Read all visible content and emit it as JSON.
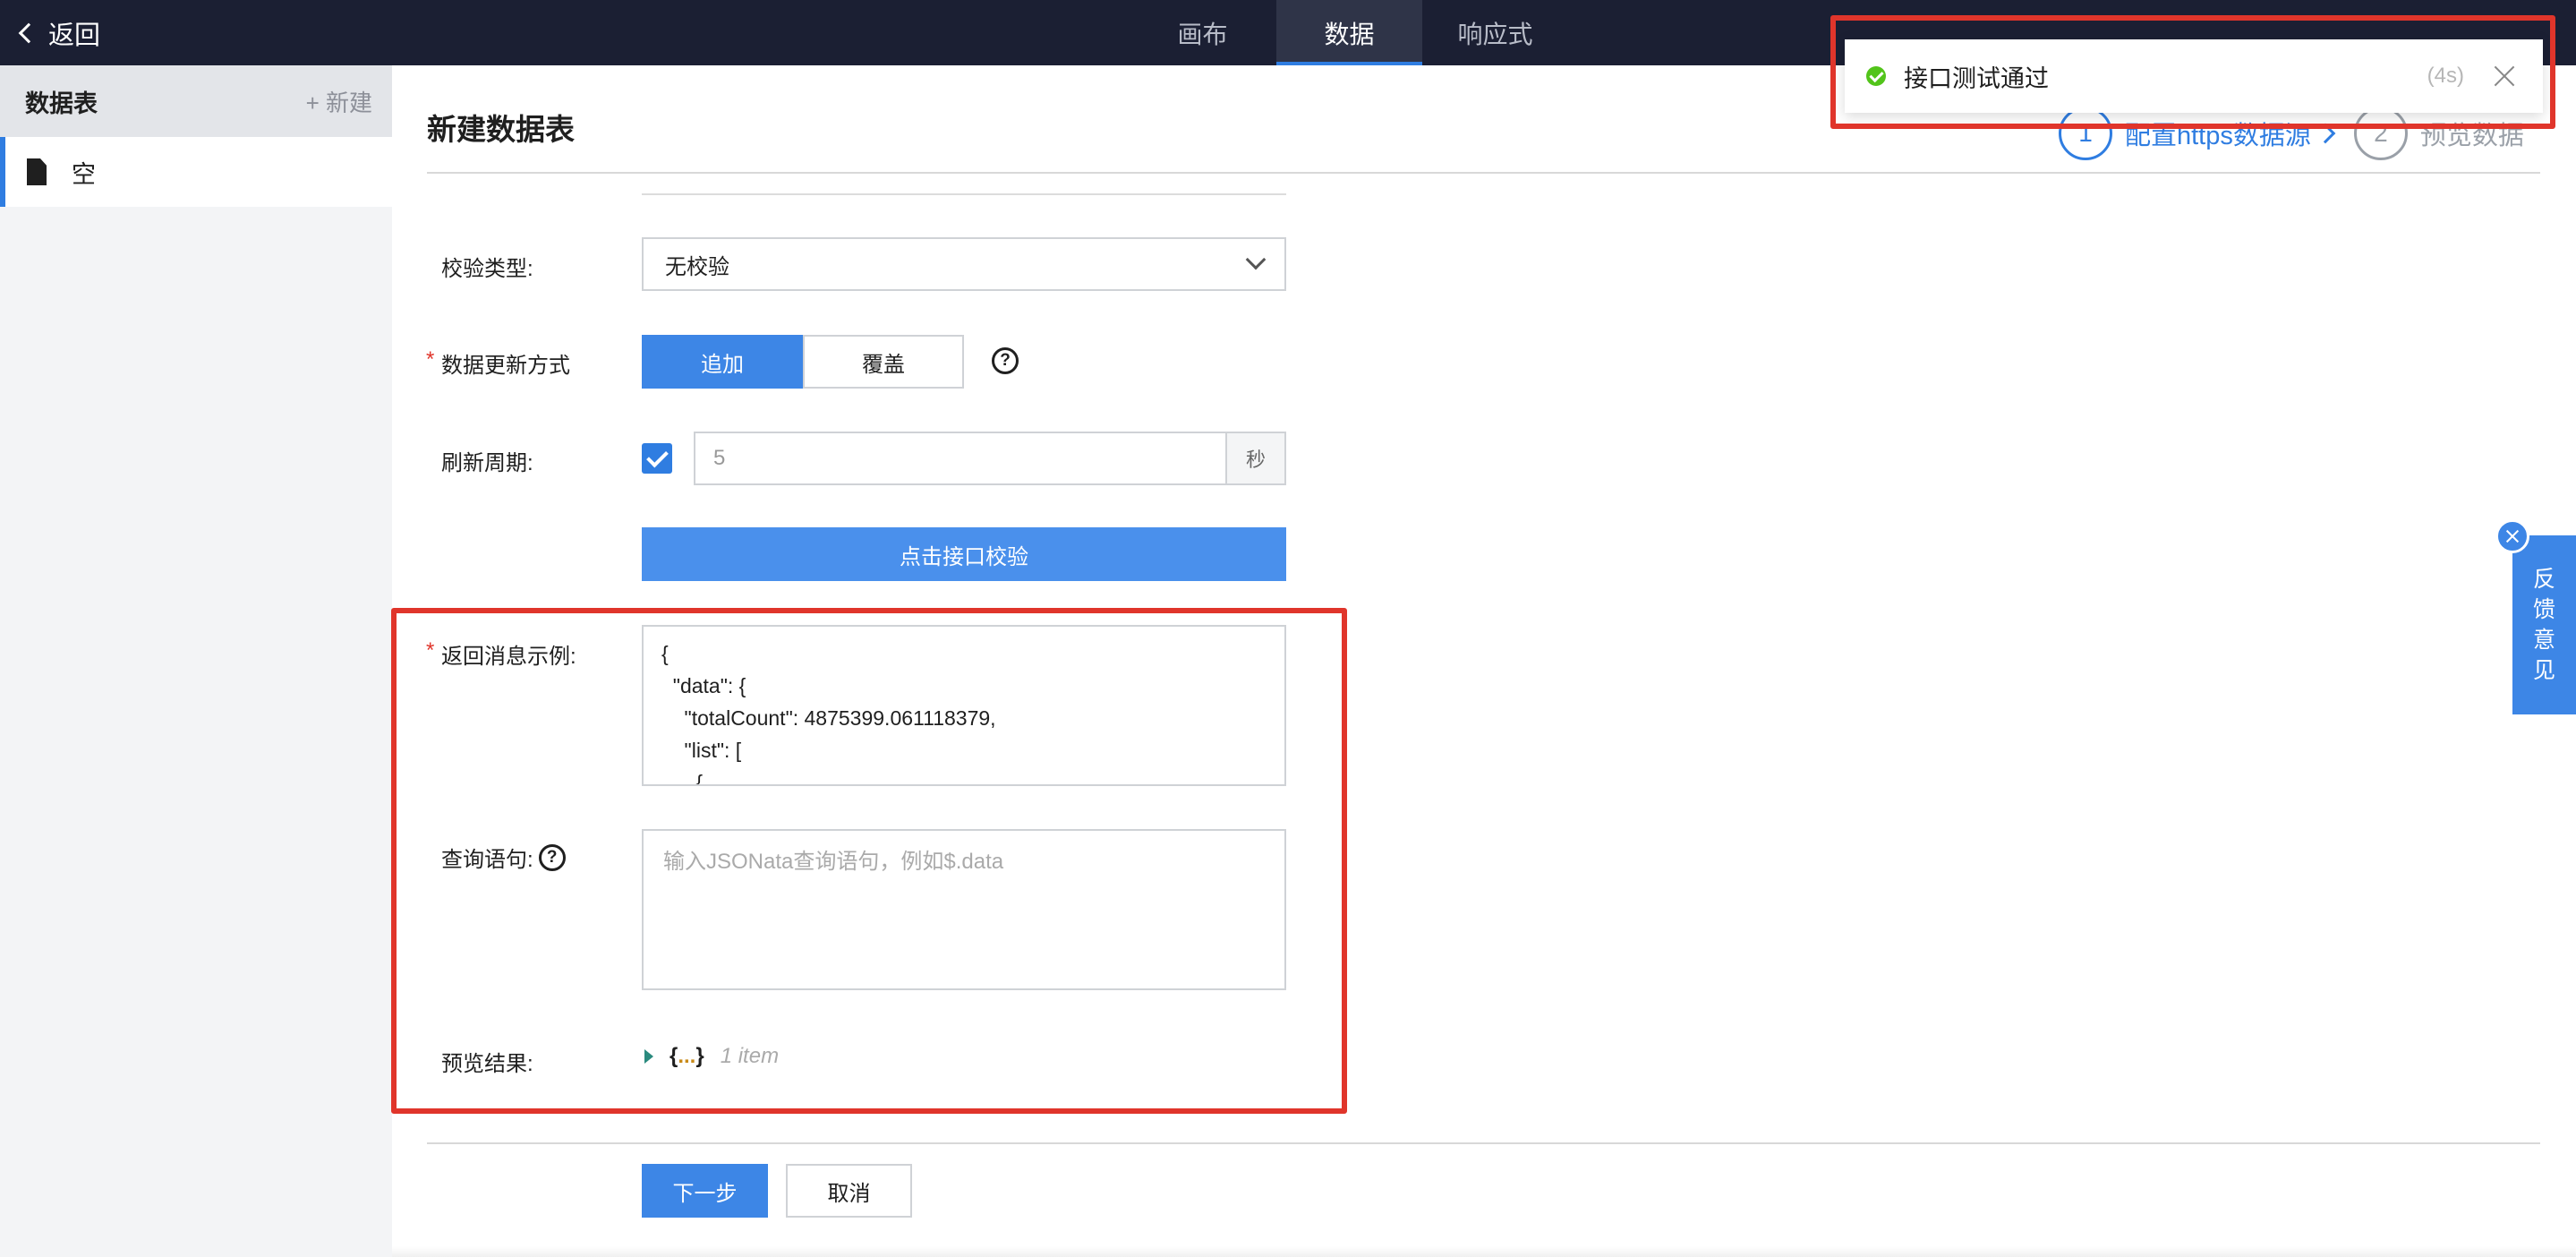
{
  "topbar": {
    "back_label": "返回",
    "tabs": [
      {
        "label": "画布",
        "active": false
      },
      {
        "label": "数据",
        "active": true
      },
      {
        "label": "响应式",
        "active": false
      }
    ]
  },
  "sidebar": {
    "title": "数据表",
    "new_label": "+ 新建",
    "items": [
      {
        "label": "空",
        "icon": "document-icon"
      }
    ]
  },
  "main": {
    "title": "新建数据表",
    "steps": [
      {
        "number": "1",
        "label": "配置https数据源"
      },
      {
        "number": "2",
        "label": "预览数据"
      }
    ]
  },
  "form": {
    "validation": {
      "label": "校验类型:",
      "value": "无校验"
    },
    "update_mode": {
      "label": "数据更新方式",
      "options": [
        "追加",
        "覆盖"
      ],
      "selected": "追加",
      "help": "?"
    },
    "refresh": {
      "label": "刷新周期:",
      "checked": true,
      "value": "5",
      "unit": "秒"
    },
    "test_button": "点击接口校验",
    "response_example": {
      "label": "返回消息示例:",
      "code": "{\n  \"data\": {\n    \"totalCount\": 4875399.061118379,\n    \"list\": [\n      {"
    },
    "query": {
      "label": "查询语句:",
      "help": "?",
      "placeholder": "输入JSONata查询语句，例如$.data"
    },
    "preview": {
      "label": "预览结果:",
      "open_brace": "{",
      "ellipsis": "...",
      "close_brace": "}",
      "count": "1 item"
    }
  },
  "footer": {
    "next": "下一步",
    "cancel": "取消"
  },
  "toast": {
    "message": "接口测试通过",
    "timer": "(4s)"
  },
  "feedback": {
    "label": [
      "反",
      "馈",
      "意",
      "见"
    ]
  },
  "colors": {
    "accent": "#3d86e6",
    "highlight": "#e0352b",
    "success": "#52c41a",
    "topbar": "#1b1f33"
  }
}
